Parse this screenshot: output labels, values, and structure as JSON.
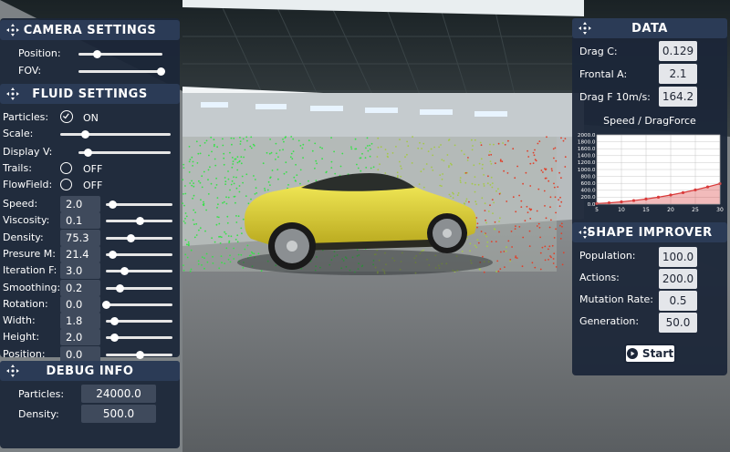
{
  "camera": {
    "title": "CAMERA SETTINGS",
    "position_label": "Position:",
    "position_value": 0.22,
    "fov_label": "FOV:",
    "fov_value": 1.0
  },
  "fluid": {
    "title": "FLUID SETTINGS",
    "particles_label": "Particles:",
    "particles_state": "ON",
    "scale_label": "Scale:",
    "scale_value": 0.22,
    "display_label": "Display V:",
    "display_value": 0.1,
    "trails_label": "Trails:",
    "trails_state": "OFF",
    "flowfield_label": "FlowField:",
    "flowfield_state": "OFF",
    "params": [
      {
        "label": "Speed:",
        "value": "2.0",
        "level": 0.1
      },
      {
        "label": "Viscosity:",
        "value": "0.1",
        "level": 0.5
      },
      {
        "label": "Density:",
        "value": "75.3",
        "level": 0.37
      },
      {
        "label": "Presure M:",
        "value": "21.4",
        "level": 0.09
      },
      {
        "label": "Iteration F:",
        "value": "3.0",
        "level": 0.27
      },
      {
        "label": "Smoothing:",
        "value": "0.2",
        "level": 0.2
      },
      {
        "label": "Rotation:",
        "value": "0.0",
        "level": 0.0
      },
      {
        "label": "Width:",
        "value": "1.8",
        "level": 0.12
      },
      {
        "label": "Height:",
        "value": "2.0",
        "level": 0.13
      },
      {
        "label": "Position:",
        "value": "0.0",
        "level": 0.5
      }
    ]
  },
  "debug": {
    "title": "DEBUG INFO",
    "particles_label": "Particles:",
    "particles_value": "24000.0",
    "density_label": "Density:",
    "density_value": "500.0"
  },
  "data": {
    "title": "DATA",
    "drag_c_label": "Drag C:",
    "drag_c_value": "0.129",
    "frontal_label": "Frontal A:",
    "frontal_value": "2.1",
    "dragf_label": "Drag F 10m/s:",
    "dragf_value": "164.2",
    "chart_title": "Speed / DragForce"
  },
  "chart_data": {
    "type": "line",
    "title": "Speed / DragForce",
    "x": [
      5,
      7.5,
      10,
      12.5,
      15,
      17.5,
      20,
      22.5,
      25,
      27.5,
      30
    ],
    "series": [
      {
        "values": [
          16,
          37,
          66,
          103,
          148,
          201,
          263,
          332,
          411,
          497,
          591
        ]
      }
    ],
    "xticks": [
      "5",
      "10",
      "15",
      "20",
      "25",
      "30"
    ],
    "yticks": [
      "0.0",
      "200.0",
      "400.0",
      "600.0",
      "800.0",
      "1000.0",
      "1200.0",
      "1400.0",
      "1600.0",
      "1800.0",
      "2000.0"
    ],
    "xlim": [
      5,
      30
    ],
    "ylim": [
      0,
      2000
    ],
    "grid": true,
    "colors": {
      "line": "#d93b3b",
      "fill": "#d93b3b",
      "bg": "#ffffff"
    }
  },
  "improver": {
    "title": "SHAPE IMPROVER",
    "rows": [
      {
        "label": "Population:",
        "value": "100.0"
      },
      {
        "label": "Actions:",
        "value": "200.0"
      },
      {
        "label": "Mutation Rate:",
        "value": "0.5"
      },
      {
        "label": "Generation:",
        "value": "50.0"
      }
    ],
    "start_label": "Start"
  }
}
